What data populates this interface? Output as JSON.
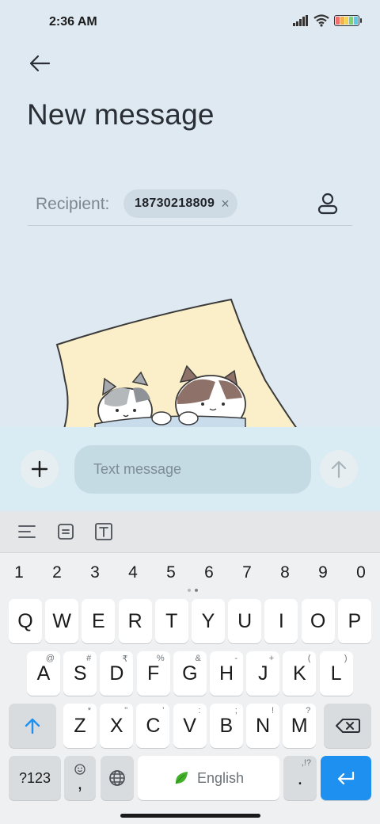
{
  "status": {
    "time": "2:36 AM",
    "battery_colors": [
      "#f07070",
      "#f2b04f",
      "#f2d34f",
      "#7cd36b",
      "#5dc7e6"
    ]
  },
  "header": {
    "back_icon": "arrow-left-icon",
    "title": "New message"
  },
  "recipient": {
    "label": "Recipient:",
    "chip_number": "18730218809",
    "chip_remove_glyph": "×",
    "contact_icon": "person-icon"
  },
  "compose": {
    "add_glyph": "+",
    "placeholder": "Text message",
    "send_icon": "arrow-up-icon"
  },
  "keyboard": {
    "toolbar_icons": [
      "menu-lines-icon",
      "clipboard-icon",
      "text-format-icon"
    ],
    "numbers": [
      "1",
      "2",
      "3",
      "4",
      "5",
      "6",
      "7",
      "8",
      "9",
      "0"
    ],
    "row1": [
      {
        "key": "Q",
        "hint": ""
      },
      {
        "key": "W",
        "hint": ""
      },
      {
        "key": "E",
        "hint": ""
      },
      {
        "key": "R",
        "hint": ""
      },
      {
        "key": "T",
        "hint": ""
      },
      {
        "key": "Y",
        "hint": ""
      },
      {
        "key": "U",
        "hint": ""
      },
      {
        "key": "I",
        "hint": ""
      },
      {
        "key": "O",
        "hint": ""
      },
      {
        "key": "P",
        "hint": ""
      }
    ],
    "row2": [
      {
        "key": "A",
        "hint": "@"
      },
      {
        "key": "S",
        "hint": "#"
      },
      {
        "key": "D",
        "hint": "₹"
      },
      {
        "key": "F",
        "hint": "%"
      },
      {
        "key": "G",
        "hint": "&"
      },
      {
        "key": "H",
        "hint": "-"
      },
      {
        "key": "J",
        "hint": "+"
      },
      {
        "key": "K",
        "hint": "("
      },
      {
        "key": "L",
        "hint": ")"
      }
    ],
    "row3": [
      {
        "key": "Z",
        "hint": "*"
      },
      {
        "key": "X",
        "hint": "\""
      },
      {
        "key": "C",
        "hint": "'"
      },
      {
        "key": "V",
        "hint": ":"
      },
      {
        "key": "B",
        "hint": ";"
      },
      {
        "key": "N",
        "hint": "!"
      },
      {
        "key": "M",
        "hint": "?"
      }
    ],
    "symbols_key": "?123",
    "comma_key": ",",
    "space_label": "English",
    "period_key": ".",
    "period_hint": ",!?",
    "accent_color": "#1e90f0"
  }
}
